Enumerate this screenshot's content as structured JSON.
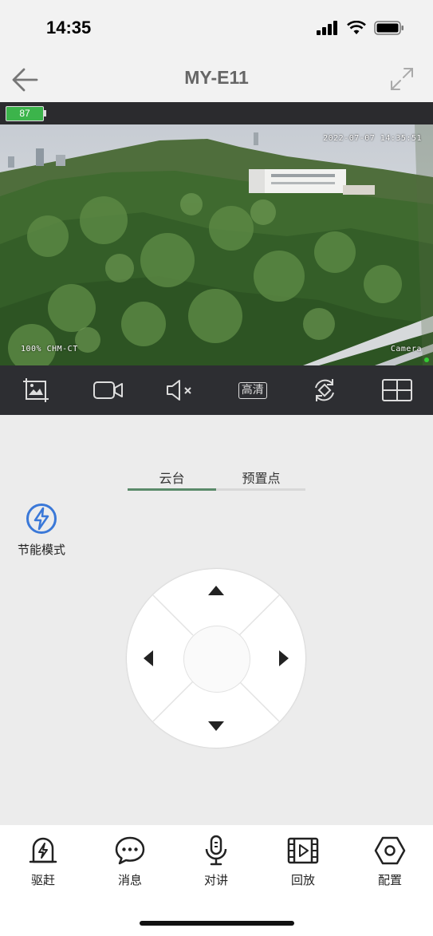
{
  "status_bar": {
    "time": "14:35"
  },
  "nav": {
    "title": "MY-E11"
  },
  "battery": {
    "level": "87"
  },
  "video": {
    "timestamp": "2022-07-07  14:35:51",
    "osd_left": "100%  CHM-CT",
    "osd_right": "Camera"
  },
  "toolbar": {
    "hd_label": "高清"
  },
  "tabs": [
    {
      "label": "云台",
      "active": true
    },
    {
      "label": "预置点",
      "active": false
    }
  ],
  "power_mode": {
    "label": "节能模式",
    "accent": "#3a78d8"
  },
  "bottom_nav": [
    {
      "label": "驱赶",
      "icon": "alarm-icon"
    },
    {
      "label": "消息",
      "icon": "message-icon"
    },
    {
      "label": "对讲",
      "icon": "microphone-icon"
    },
    {
      "label": "回放",
      "icon": "playback-icon"
    },
    {
      "label": "配置",
      "icon": "settings-icon"
    }
  ],
  "colors": {
    "tab_active": "#5a8a6a",
    "toolbar_bg": "#2d2e32",
    "battery_green": "#3cb44b"
  }
}
